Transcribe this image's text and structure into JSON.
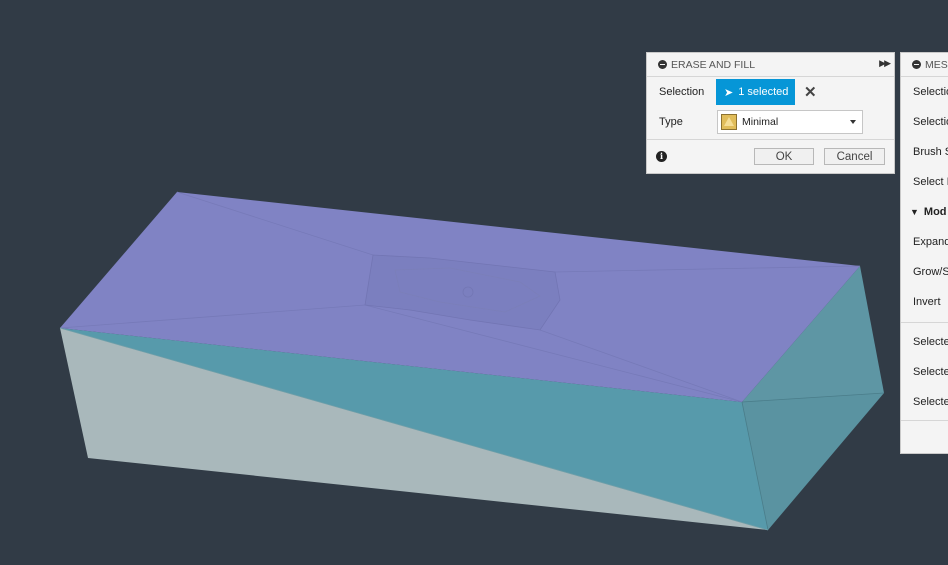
{
  "erase_fill": {
    "title": "ERASE AND FILL",
    "selection_label": "Selection",
    "selection_value": "1 selected",
    "type_label": "Type",
    "type_value": "Minimal",
    "ok_label": "OK",
    "cancel_label": "Cancel",
    "icons": [
      "collapse-icon",
      "expand-arrows-icon",
      "cursor-icon",
      "clear-icon",
      "triangle-type-icon",
      "dropdown-caret-icon",
      "info-icon"
    ]
  },
  "mesh_panel": {
    "title": "MESI",
    "rows": [
      "Selectio",
      "Selectio",
      "Brush S",
      "Select I"
    ],
    "section_title": "Mod",
    "section_rows": [
      "Expand",
      "Grow/S",
      "Invert"
    ],
    "bottom_rows": [
      "Selecte",
      "Selecte",
      "Selecte"
    ]
  },
  "colors": {
    "background": "#313b46",
    "top_face": "#8083c4",
    "front_face": "#579aab",
    "left_face": "#a9b8bb",
    "right_face": "#5a93a1",
    "selection_blue": "#0696d7"
  }
}
